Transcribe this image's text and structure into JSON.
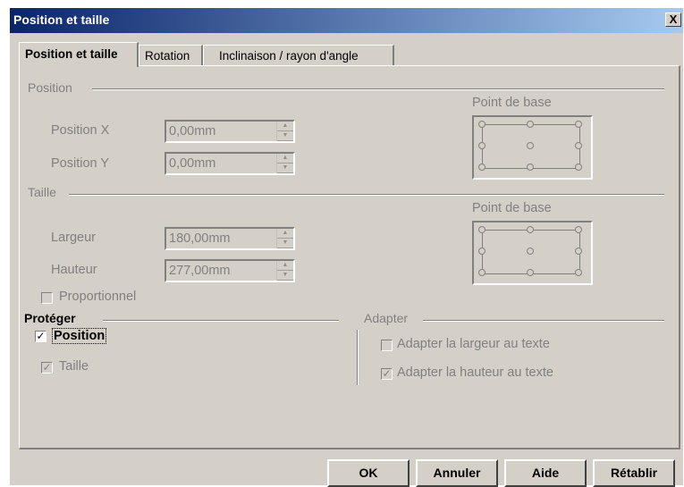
{
  "window": {
    "title": "Position et taille",
    "close_label": "X"
  },
  "tabs": [
    "Position et taille",
    "Rotation",
    "Inclinaison / rayon d'angle"
  ],
  "position": {
    "group_label": "Position",
    "x_label": "Position X",
    "x_value": "0,00mm",
    "y_label": "Position Y",
    "y_value": "0,00mm",
    "base_point_label": "Point de base"
  },
  "size": {
    "group_label": "Taille",
    "width_label": "Largeur",
    "width_value": "180,00mm",
    "height_label": "Hauteur",
    "height_value": "277,00mm",
    "proportional_label": "Proportionnel",
    "proportional_checked": false,
    "base_point_label": "Point de base"
  },
  "protect": {
    "group_label": "Protéger",
    "position_label": "Position",
    "position_checked": true,
    "size_label": "Taille",
    "size_checked": true
  },
  "fit": {
    "group_label": "Adapter",
    "fit_width_label": "Adapter la largeur au texte",
    "fit_width_checked": false,
    "fit_height_label": "Adapter la hauteur au texte",
    "fit_height_checked": true
  },
  "buttons": {
    "ok": "OK",
    "cancel": "Annuler",
    "help": "Aide",
    "reset": "Rétablir"
  }
}
